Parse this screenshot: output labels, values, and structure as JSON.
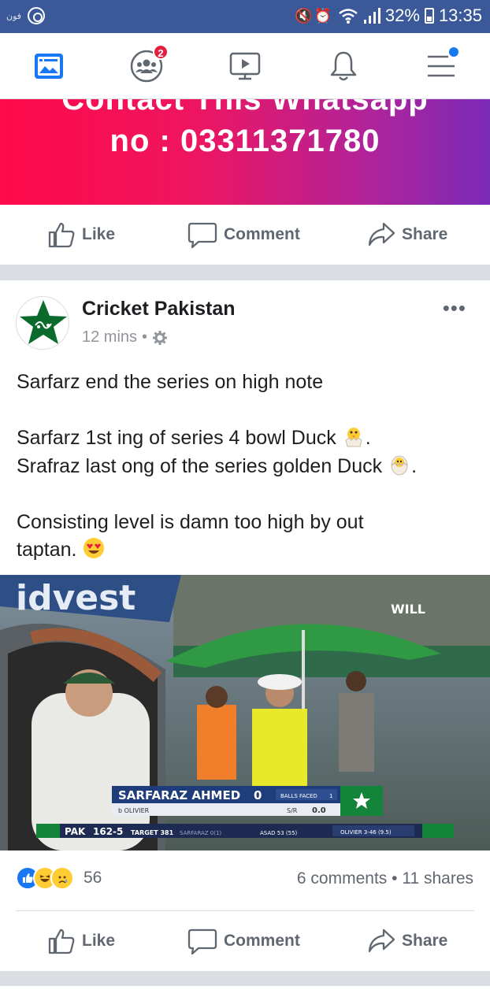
{
  "status_bar": {
    "carrier": "فون",
    "battery": "32%",
    "time": "13:35"
  },
  "tabs": {
    "news_feed": "news-feed",
    "friends_badge": "2",
    "watch": "watch",
    "notifications": "notifications",
    "menu": "menu"
  },
  "banner": {
    "line1": "Contact This Whatsapp",
    "line2": "no : 03311371780"
  },
  "actions": {
    "like": "Like",
    "comment": "Comment",
    "share": "Share"
  },
  "post": {
    "page_name": "Cricket Pakistan",
    "time": "12 mins",
    "lines": [
      "Sarfarz end the series on high note",
      "Sarfarz 1st ing of series 4 bowl Duck",
      "Srafraz last ong of the series golden Duck",
      "Consisting level is damn too high by out",
      "taptan."
    ],
    "reaction_count": "56",
    "comments": "6 comments",
    "shares": "11 shares"
  },
  "media": {
    "sponsor": "idvest",
    "channel": "WILL",
    "player_name": "SARFARAZ AHMED",
    "player_runs": "0",
    "dismissal": "b OLIVIER",
    "balls_faced_label": "BALLS FACED",
    "balls_faced": "1",
    "sr_label": "S/R",
    "sr": "0.0",
    "team": "PAK",
    "score": "162-5",
    "target": "TARGET 381",
    "ticker_1": "SARFARAZ 0(1)",
    "ticker_2": "ASAD 53 (55)",
    "ticker_3": "OLIVIER 3-46 (9.5)"
  },
  "colors": {
    "status_bar": "#3b5998",
    "fb_blue": "#1877f2",
    "badge_red": "#e41e3f",
    "banner_start": "#ff0a4a",
    "banner_end": "#7a2bb8"
  }
}
